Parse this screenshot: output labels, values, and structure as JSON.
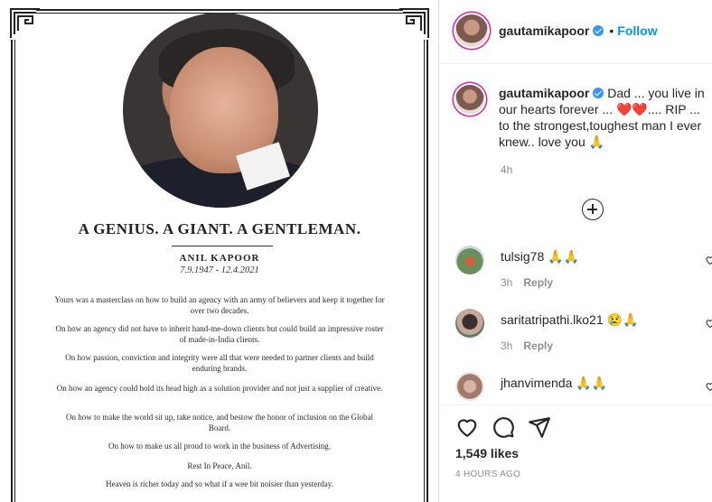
{
  "post_image": {
    "headline": "A GENIUS. A GIANT. A GENTLEMAN.",
    "name": "ANIL KAPOOR",
    "dates": "7.9.1947 - 12.4.2021",
    "paragraphs": [
      "Yours was a masterclass on how to build an agency with an army of believers and keep it together for over two decades.",
      "On how an agency did not have to inherit hand-me-down clients but could build an impressive roster of made-in-India clients.",
      "On how passion, conviction and integrity were all that were needed to partner clients and build enduring brands.",
      "On how an agency could hold its head high as a solution provider and not just a supplier of creative.",
      "On how to make the world sit up, take notice, and bestow the honor of inclusion on the Global Board.",
      "On how to make us all proud to work in the business of Advertising.",
      "Rest In Peace, Anil.",
      "Heaven is richer today and so what if a wee bit noisier than yesterday."
    ]
  },
  "header": {
    "username": "gautamikapoor",
    "separator": "•",
    "follow_label": "Follow"
  },
  "caption": {
    "username": "gautamikapoor",
    "text": "Dad ... you live in our hearts forever ... ❤️❤️.... RIP ... to the strongest,toughest man I ever knew.. love you 🙏",
    "time": "4h"
  },
  "comments": [
    {
      "username": "tulsig78",
      "text": "🙏🙏",
      "time": "3h",
      "reply_label": "Reply"
    },
    {
      "username": "saritatripathi.lko21",
      "text": "😢🙏",
      "time": "3h",
      "reply_label": "Reply"
    },
    {
      "username": "jhanvimenda",
      "text": "🙏🙏",
      "time": "",
      "reply_label": ""
    }
  ],
  "footer": {
    "likes": "1,549 likes",
    "posted_ago": "4 HOURS AGO"
  },
  "icons": [
    "heart-icon",
    "comment-icon",
    "share-icon",
    "verified-icon",
    "add-comment-icon"
  ],
  "colors": {
    "link": "#0095f6",
    "verified": "#3897f0",
    "muted": "#8e8e8e"
  }
}
